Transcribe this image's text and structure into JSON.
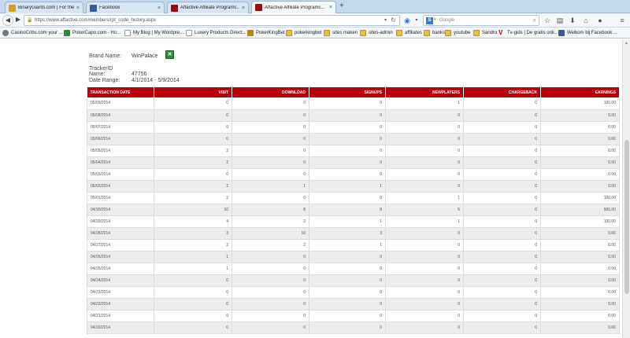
{
  "browser": {
    "tabs": [
      {
        "label": "BinaryGiants.com | For the best ...",
        "favicon_color": "#d9a020"
      },
      {
        "label": "Facebook",
        "favicon_color": "#3b5998"
      },
      {
        "label": "Affactive Affiliate Programc...",
        "favicon_color": "#9b0a0a"
      },
      {
        "label": "Affactive Affiliate Programc...",
        "favicon_color": "#9b0a0a"
      }
    ],
    "new_tab_label": "+",
    "url": "https://www.affactive.com/members/rpt_code_history.aspx",
    "search_placeholder": "Google",
    "search_engine_badge": "S",
    "bookmarks": [
      "CasinoCribs.com your ...",
      "PokerCapo.com - Ho...",
      "My Blog | My Wordpre...",
      "Luxery Products Direct...",
      "PokerKingBet",
      "pokerkingbet",
      "sites maken",
      "sites-admin",
      "affiliates",
      "banks",
      "youtube",
      "Sandro",
      "Tv-gids | De gratis onli...",
      "Welkom bij Facebook ..."
    ]
  },
  "report": {
    "brand_label": "Brand Name:",
    "brand_value": "WinPalace",
    "tracker_label": "TrackerID Name:",
    "tracker_value": "47756",
    "range_label": "Date Range:",
    "range_value": "4/1/2014 - 5/9/2014",
    "columns": [
      "TRANSACTION DATE",
      "VISIT",
      "DOWNLOAD",
      "SIGNUPS",
      "NEWPLAYERS",
      "CHARGEBACK",
      "EARNINGS"
    ],
    "rows": [
      [
        "05/09/2014",
        "0",
        "0",
        "0",
        "1",
        "0",
        "100.00"
      ],
      [
        "05/08/2014",
        "0",
        "0",
        "0",
        "0",
        "0",
        "0.00"
      ],
      [
        "05/07/2014",
        "0",
        "0",
        "0",
        "0",
        "0",
        "0.00"
      ],
      [
        "05/06/2014",
        "0",
        "0",
        "0",
        "0",
        "0",
        "0.00"
      ],
      [
        "05/05/2014",
        "2",
        "0",
        "0",
        "0",
        "0",
        "0.00"
      ],
      [
        "05/04/2014",
        "2",
        "0",
        "0",
        "0",
        "0",
        "0.00"
      ],
      [
        "05/03/2014",
        "0",
        "0",
        "0",
        "0",
        "0",
        "0.00"
      ],
      [
        "05/02/2014",
        "2",
        "1",
        "1",
        "0",
        "0",
        "0.00"
      ],
      [
        "05/01/2014",
        "2",
        "0",
        "0",
        "1",
        "0",
        "100.00"
      ],
      [
        "04/30/2014",
        "10",
        "8",
        "8",
        "5",
        "0",
        "900.00"
      ],
      [
        "04/29/2014",
        "4",
        "2",
        "1",
        "1",
        "0",
        "100.00"
      ],
      [
        "04/28/2014",
        "3",
        "10",
        "3",
        "0",
        "0",
        "0.00"
      ],
      [
        "04/27/2014",
        "2",
        "2",
        "1",
        "0",
        "0",
        "0.00"
      ],
      [
        "04/26/2014",
        "1",
        "0",
        "0",
        "0",
        "0",
        "0.00"
      ],
      [
        "04/25/2014",
        "1",
        "0",
        "0",
        "0",
        "0",
        "0.00"
      ],
      [
        "04/24/2014",
        "0",
        "0",
        "0",
        "0",
        "0",
        "0.00"
      ],
      [
        "04/23/2014",
        "0",
        "0",
        "0",
        "0",
        "0",
        "0.00"
      ],
      [
        "04/22/2014",
        "0",
        "0",
        "0",
        "0",
        "0",
        "0.00"
      ],
      [
        "04/21/2014",
        "0",
        "0",
        "0",
        "0",
        "0",
        "0.00"
      ],
      [
        "04/20/2014",
        "0",
        "0",
        "0",
        "0",
        "0",
        "0.00"
      ]
    ]
  }
}
